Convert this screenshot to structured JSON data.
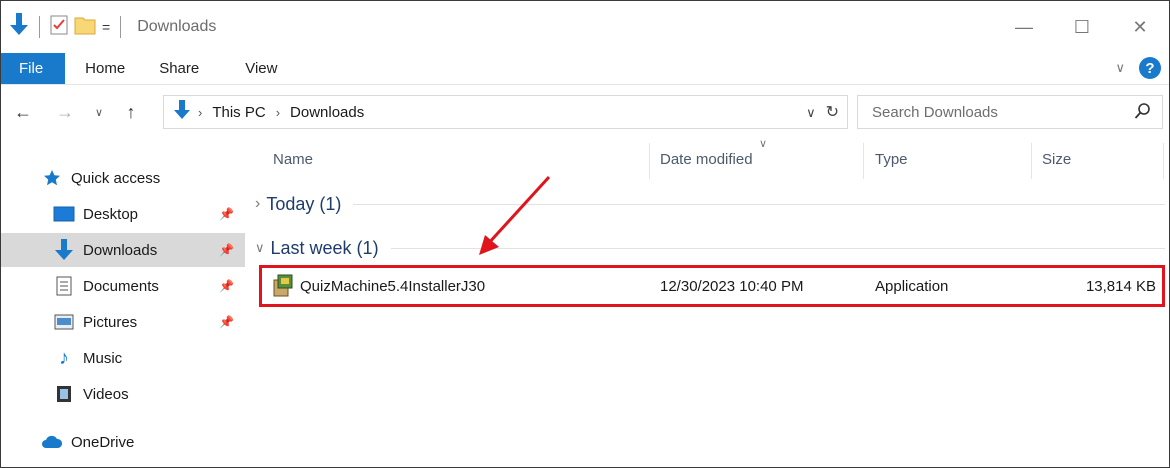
{
  "window": {
    "title": "Downloads",
    "controls": {
      "minimize": "—",
      "maximize": "☐",
      "close": "✕"
    }
  },
  "qat": {
    "dropdown": "="
  },
  "ribbon": {
    "tabs": [
      "File",
      "Home",
      "Share",
      "View"
    ],
    "collapse": "∨",
    "help": "?"
  },
  "address": {
    "crumbs": [
      "This PC",
      "Downloads"
    ],
    "search_placeholder": "Search Downloads"
  },
  "sidebar": {
    "items": [
      {
        "label": "Quick access",
        "icon": "star-icon",
        "pinned": false
      },
      {
        "label": "Desktop",
        "icon": "desktop-icon",
        "pinned": true
      },
      {
        "label": "Downloads",
        "icon": "download-icon",
        "pinned": true,
        "selected": true
      },
      {
        "label": "Documents",
        "icon": "documents-icon",
        "pinned": true
      },
      {
        "label": "Pictures",
        "icon": "pictures-icon",
        "pinned": true
      },
      {
        "label": "Music",
        "icon": "music-icon",
        "pinned": false
      },
      {
        "label": "Videos",
        "icon": "videos-icon",
        "pinned": false
      },
      {
        "label": "OneDrive",
        "icon": "cloud-icon",
        "pinned": false
      }
    ]
  },
  "columns": {
    "name": "Name",
    "date": "Date modified",
    "type": "Type",
    "size": "Size"
  },
  "groups": [
    {
      "label": "Today (1)",
      "expanded": false
    },
    {
      "label": "Last week (1)",
      "expanded": true
    }
  ],
  "files": [
    {
      "name": "QuizMachine5.4InstallerJ30",
      "date": "12/30/2023 10:40 PM",
      "type": "Application",
      "size": "13,814 KB"
    }
  ],
  "colors": {
    "accent": "#1979ca",
    "highlight": "#e0141c",
    "group_text": "#1e3c6e"
  }
}
